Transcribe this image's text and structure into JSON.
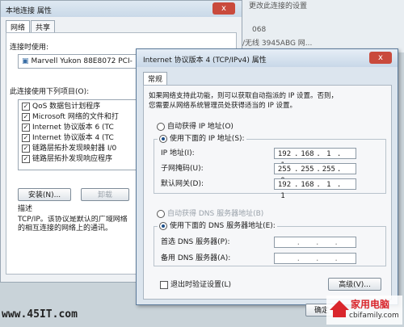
{
  "bg_window": {
    "title": "本地连接 属性",
    "close_label": "x",
    "tabs": [
      "网络",
      "共享"
    ],
    "connect_using_label": "连接时使用:",
    "adapter_name": "Marvell Yukon 88E8072 PCI-",
    "items_label": "此连接使用下列项目(O):",
    "items": [
      {
        "label": "QoS 数据包计划程序",
        "checked": true
      },
      {
        "label": "Microsoft 网络的文件和打",
        "checked": true
      },
      {
        "label": "Internet 协议版本 6 (TC",
        "checked": true
      },
      {
        "label": "Internet 协议版本 4 (TC",
        "checked": true
      },
      {
        "label": "链路层拓扑发现映射器 I/0",
        "checked": true
      },
      {
        "label": "链路层拓扑发现响应程序",
        "checked": true
      }
    ],
    "install_button": "安装(N)...",
    "uninstall_button": "卸载",
    "description_label": "描述",
    "description_text": "TCP/IP。该协议是默认的广域网络\n的相互连接的网络上的通讯。"
  },
  "bg_right": {
    "line1": "更改此连接的设置",
    "line2": "068",
    "line3": "/无线 3945ABG 网..."
  },
  "dialog": {
    "title": "Internet 协议版本 4 (TCP/IPv4) 属性",
    "close_label": "x",
    "tab": "常规",
    "intro_line1": "如果网络支持此功能，则可以获取自动指派的 IP 设置。否则，",
    "intro_line2": "您需要从网络系统管理员处获得适当的 IP 设置。",
    "auto_ip_label": "自动获得 IP 地址(O)",
    "manual_ip_label": "使用下面的 IP 地址(S):",
    "ip_label": "IP 地址(I):",
    "ip_value": [
      "192",
      "168",
      "1",
      "1"
    ],
    "mask_label": "子网掩码(U):",
    "mask_value": [
      "255",
      "255",
      "255",
      "0"
    ],
    "gateway_label": "默认网关(D):",
    "gateway_value": [
      "192",
      "168",
      "1",
      "1"
    ],
    "auto_dns_label": "自动获得 DNS 服务器地址(B)",
    "manual_dns_label": "使用下面的 DNS 服务器地址(E):",
    "dns1_label": "首选 DNS 服务器(P):",
    "dns2_label": "备用 DNS 服务器(A):",
    "validate_label": "退出时验证设置(L)",
    "advanced_button": "高级(V)...",
    "ok_button": "确定"
  },
  "watermark_left": "www.45IT.com",
  "watermark_right_top": "家用电脑",
  "watermark_right_bottom": "cbifamily.com",
  "colors": {
    "title_bar": "#c8d8e8",
    "dialog_bg": "#dce5ee",
    "watermark_red": "#d9262c"
  }
}
